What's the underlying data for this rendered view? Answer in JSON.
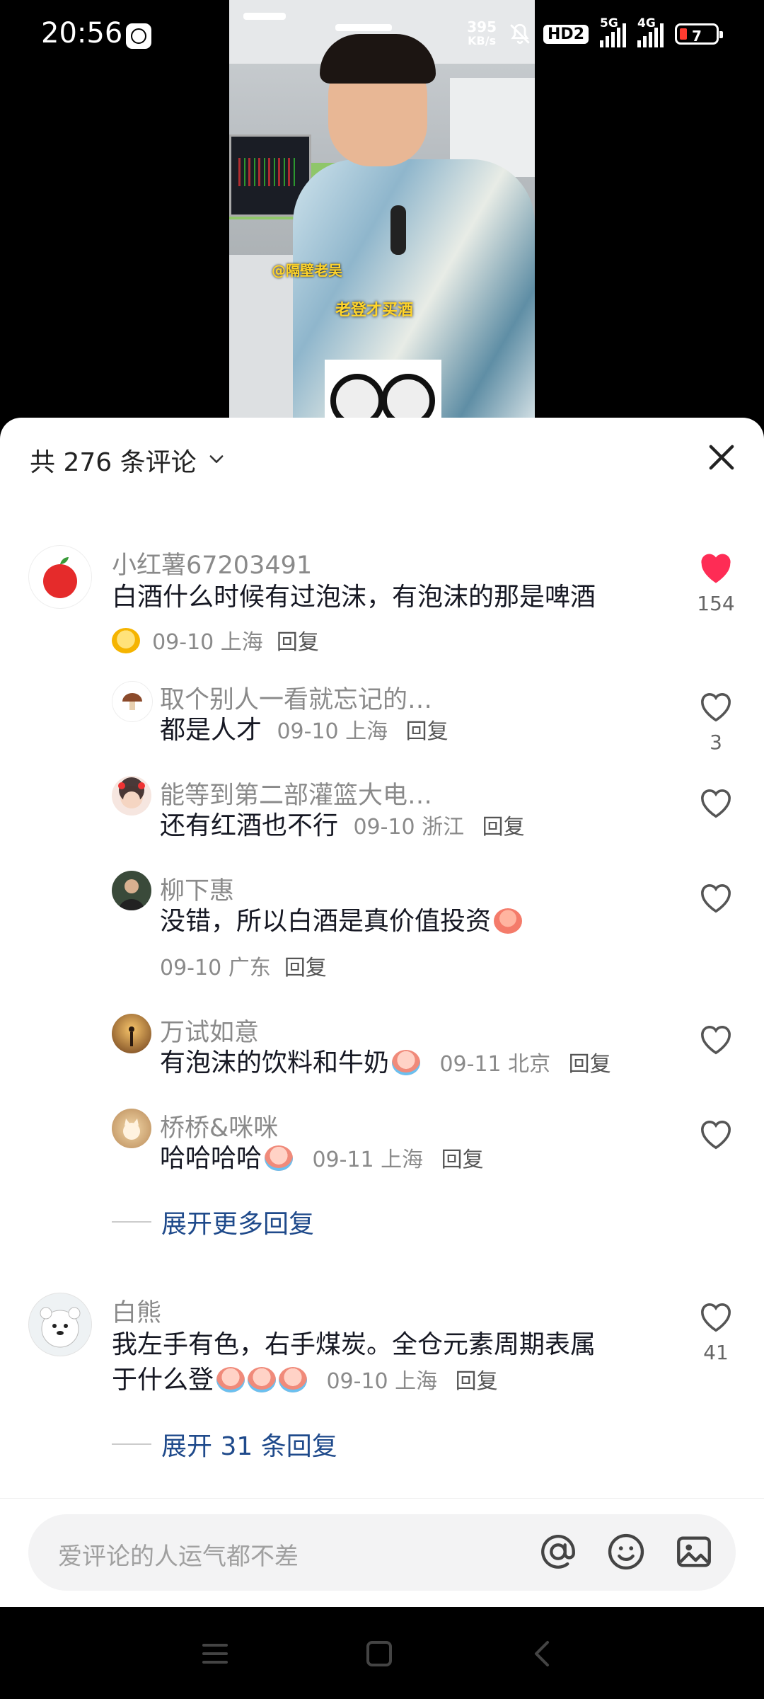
{
  "status_bar": {
    "time": "20:56",
    "net_speed_value": "395",
    "net_speed_unit": "KB/s",
    "hd_badge": "HD2",
    "signal_1_label": "5G",
    "signal_2_label": "4G",
    "battery": "7"
  },
  "video": {
    "mention_tag": "@隔壁老吴",
    "caption": "老登才买酒"
  },
  "sheet": {
    "comment_count_label": "共 276 条评论",
    "accent_color": "#fe2c55",
    "link_color": "#1f4a8b"
  },
  "comments": [
    {
      "username": "小红薯67203491",
      "text": "白酒什么时候有过泡沫，有泡沫的那是啤酒",
      "meta": "09-10 上海",
      "reply_label": "回复",
      "likes": "154",
      "liked": true
    },
    {
      "username": "白熊",
      "text_line1": "我左手有色，右手煤炭。全仓元素周期表属",
      "text_line2": "于什么登",
      "meta": "09-10 上海",
      "reply_label": "回复",
      "likes": "41",
      "liked": false
    }
  ],
  "replies": [
    {
      "username": "取个别人一看就忘记的…",
      "text": "都是人才",
      "meta": "09-10 上海",
      "reply_label": "回复",
      "likes": "3"
    },
    {
      "username": "能等到第二部灌篮大电…",
      "text": "还有红酒也不行",
      "meta": "09-10 浙江",
      "reply_label": "回复",
      "likes": ""
    },
    {
      "username": "柳下惠",
      "text": "没错，所以白酒是真价值投资",
      "meta": "09-10 广东",
      "reply_label": "回复",
      "likes": ""
    },
    {
      "username": "万试如意",
      "text": "有泡沫的饮料和牛奶",
      "meta": "09-11 北京",
      "reply_label": "回复",
      "likes": ""
    },
    {
      "username": "桥桥&咪咪",
      "text": "哈哈哈哈",
      "meta": "09-11 上海",
      "reply_label": "回复",
      "likes": ""
    }
  ],
  "expand_more_label": "展开更多回复",
  "expand_31_label": "展开 31 条回复",
  "input": {
    "placeholder": "爱评论的人运气都不差"
  },
  "icons": {
    "close": "close-icon",
    "heart": "heart-icon",
    "at": "at-icon",
    "emoji": "emoji-icon",
    "image": "image-icon"
  }
}
